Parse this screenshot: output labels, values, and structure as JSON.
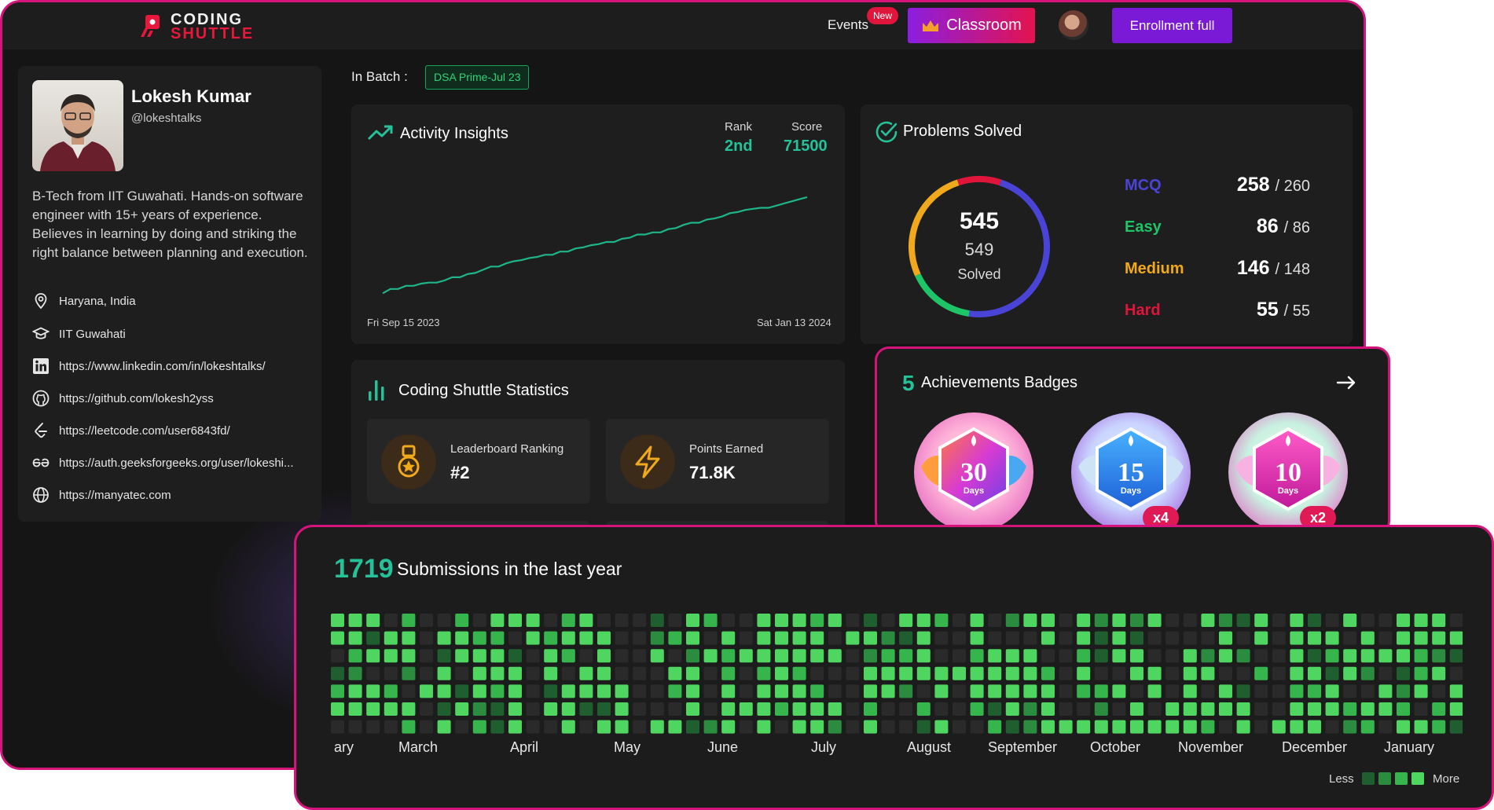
{
  "header": {
    "logo_line1": "CODING",
    "logo_line2": "SHUTTLE",
    "events_label": "Events",
    "new_badge": "New",
    "classroom_label": "Classroom",
    "enroll_label": "Enrollment full"
  },
  "profile": {
    "name": "Lokesh Kumar",
    "handle": "@lokeshtalks",
    "bio": "B-Tech from IIT Guwahati. Hands-on software engineer with 15+ years of experience. Believes in learning by doing and striking the right balance between planning and execution.",
    "location": "Haryana, India",
    "college": "IIT Guwahati",
    "linkedin": "https://www.linkedin.com/in/lokeshtalks/",
    "github": "https://github.com/lokesh2yss",
    "leetcode": "https://leetcode.com/user6843fd/",
    "gfg": "https://auth.geeksforgeeks.org/user/lokeshi...",
    "website": "https://manyatec.com"
  },
  "batch": {
    "label": "In Batch :",
    "name": "DSA Prime-Jul 23"
  },
  "activity": {
    "title": "Activity Insights",
    "rank_label": "Rank",
    "rank_value": "2nd",
    "score_label": "Score",
    "score_value": "71500",
    "start_date": "Fri Sep 15 2023",
    "end_date": "Sat Jan 13 2024",
    "chart_data": {
      "type": "line",
      "x_start": "Fri Sep 15 2023",
      "x_end": "Sat Jan 13 2024",
      "values": [
        2,
        6,
        6,
        9,
        9,
        11,
        12,
        12,
        14,
        17,
        17,
        20,
        21,
        24,
        27,
        27,
        30,
        32,
        33,
        35,
        36,
        38,
        38,
        41,
        41,
        44,
        45,
        47,
        48,
        50,
        50,
        53,
        54,
        57,
        57,
        59,
        59,
        62,
        63,
        66,
        68,
        68,
        71,
        72,
        74,
        77,
        78,
        80,
        81,
        82,
        82,
        84,
        86,
        88,
        90,
        92
      ]
    },
    "line_color": "#1fb58a"
  },
  "problems": {
    "title": "Problems Solved",
    "solved": "545",
    "total": "549",
    "caption": "Solved",
    "rows": [
      {
        "label": "MCQ",
        "solved": "258",
        "total": "/ 260",
        "color": "#4a44d6"
      },
      {
        "label": "Easy",
        "solved": "86",
        "total": "/ 86",
        "color": "#1ec468"
      },
      {
        "label": "Medium",
        "solved": "146",
        "total": "/ 148",
        "color": "#f0a81c"
      },
      {
        "label": "Hard",
        "solved": "55",
        "total": "/ 55",
        "color": "#e0153c"
      }
    ]
  },
  "statistics": {
    "title": "Coding Shuttle Statistics",
    "leaderboard_label": "Leaderboard Ranking",
    "leaderboard_value": "#2",
    "points_label": "Points Earned",
    "points_value": "71.8K"
  },
  "achievements": {
    "count": "5",
    "title": "Achievements Badges",
    "badges": [
      {
        "number": "30",
        "unit": "Days",
        "multiplier": ""
      },
      {
        "number": "15",
        "unit": "Days",
        "multiplier": "x4"
      },
      {
        "number": "10",
        "unit": "Days",
        "multiplier": "x2"
      }
    ]
  },
  "submissions": {
    "count": "1719",
    "title": "Submissions in the last year",
    "months": [
      "ary",
      "March",
      "April",
      "May",
      "June",
      "July",
      "August",
      "September",
      "October",
      "November",
      "December",
      "January"
    ],
    "legend_less": "Less",
    "legend_more": "More",
    "levels": [
      "#2a2a2a",
      "#1f5f2f",
      "#2b8c3f",
      "#36b54d",
      "#4fd660"
    ]
  }
}
